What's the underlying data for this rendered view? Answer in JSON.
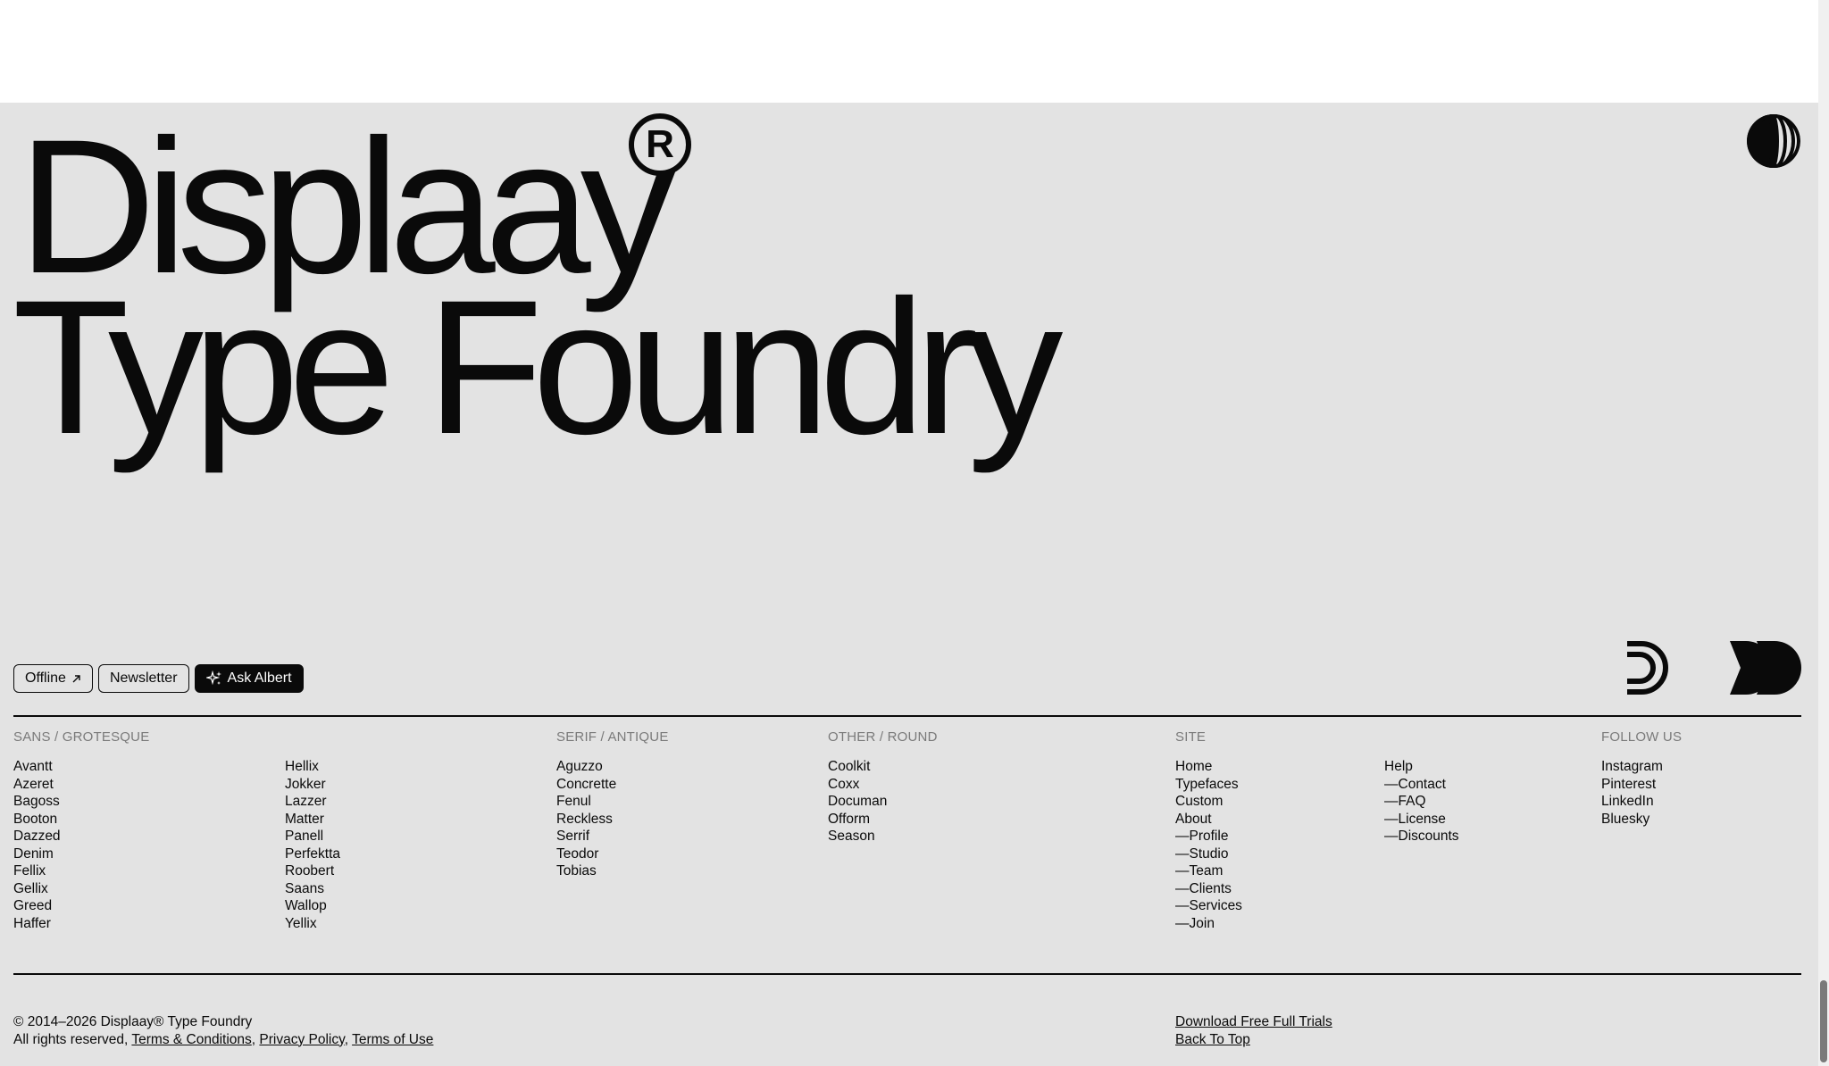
{
  "hero": {
    "line1": "Displaay",
    "reg_mark": "R",
    "line2": "Type Foundry"
  },
  "buttons": {
    "offline": "Offline",
    "newsletter": "Newsletter",
    "ask_albert": "Ask Albert"
  },
  "columns": {
    "sans": {
      "heading": "SANS / GROTESQUE",
      "items_a": [
        "Avantt",
        "Azeret",
        "Bagoss",
        "Booton",
        "Dazzed",
        "Denim",
        "Fellix",
        "Gellix",
        "Greed",
        "Haffer"
      ],
      "items_b": [
        "Hellix",
        "Jokker",
        "Lazzer",
        "Matter",
        "Panell",
        "Perfektta",
        "Roobert",
        "Saans",
        "Wallop",
        "Yellix"
      ]
    },
    "serif": {
      "heading": "SERIF / ANTIQUE",
      "items": [
        "Aguzzo",
        "Concrette",
        "Fenul",
        "Reckless",
        "Serrif",
        "Teodor",
        "Tobias"
      ]
    },
    "other": {
      "heading": "OTHER / ROUND",
      "items": [
        "Coolkit",
        "Coxx",
        "Documan",
        "Ofform",
        "Season"
      ]
    },
    "site": {
      "heading": "SITE",
      "items_a": [
        "Home",
        "Typefaces",
        "Custom",
        "About",
        "—Profile",
        "—Studio",
        "—Team",
        "—Clients",
        "—Services",
        "—Join"
      ],
      "items_b": [
        "Help",
        "—Contact",
        "—FAQ",
        "—License",
        "—Discounts"
      ]
    },
    "follow": {
      "heading": "FOLLOW US",
      "items": [
        "Instagram",
        "Pinterest",
        "LinkedIn",
        "Bluesky"
      ]
    }
  },
  "legal": {
    "copyright": "© 2014–2026 Displaay® Type Foundry",
    "rights": "All rights reserved,",
    "terms_conditions": "Terms & Conditions",
    "privacy": "Privacy Policy",
    "terms_use": "Terms of Use"
  },
  "links": {
    "download": "Download Free Full Trials",
    "back_to_top": "Back To Top"
  }
}
